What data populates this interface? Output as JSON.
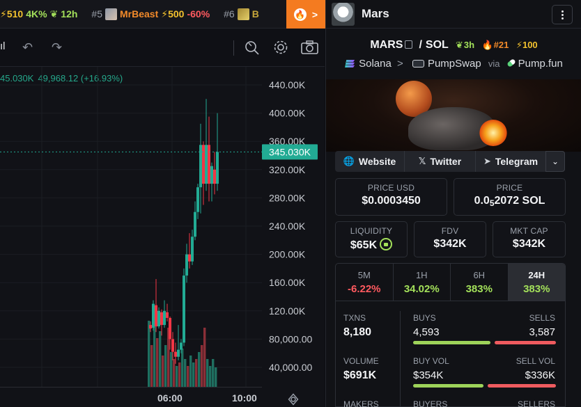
{
  "ticker": {
    "items": [
      {
        "rank": "",
        "name": "",
        "bolt": "⚡510",
        "change": "4K%",
        "change_color": "green",
        "age": "12h"
      },
      {
        "rank": "#5",
        "name": "MrBeast",
        "bolt": "⚡500",
        "change": "-60%",
        "change_color": "red",
        "age": ""
      },
      {
        "rank": "#6",
        "name": "B",
        "bolt": "",
        "change": "",
        "change_color": "",
        "age": ""
      }
    ]
  },
  "chart": {
    "ohlc_prefix": "45.030K",
    "ohlc_values": "49,968.12 (+16.93%)",
    "price_labels": [
      "440.00K",
      "400.00K",
      "360.00K",
      "320.00K",
      "280.00K",
      "240.00K",
      "200.00K",
      "160.00K",
      "120.00K",
      "80,000.00",
      "40,000.00"
    ],
    "current_price": "345.030K",
    "time_labels": [
      "06:00",
      "10:00"
    ],
    "colors": {
      "up": "#22ab94",
      "down": "#f23645",
      "current": "#22ab94"
    }
  },
  "chart_data": {
    "type": "candlestick",
    "y_axis_ticks": [
      440000,
      400000,
      360000,
      320000,
      280000,
      240000,
      200000,
      160000,
      120000,
      80000,
      40000
    ],
    "current_price": 345030,
    "x_labels": [
      "06:00",
      "10:00"
    ]
  },
  "token": {
    "name": "Mars",
    "symbol": "MARS",
    "quote": "SOL",
    "age": "3h",
    "rank": "#21",
    "boost": "100",
    "chain": "Solana",
    "dex": "PumpSwap",
    "via_label": "via",
    "launchpad": "Pump.fun"
  },
  "links": {
    "website": "Website",
    "twitter": "Twitter",
    "telegram": "Telegram"
  },
  "cards": {
    "price_usd_label": "PRICE USD",
    "price_usd": "$0.0003450",
    "price_label": "PRICE",
    "price_sol_main": "0.0",
    "price_sol_sub": "5",
    "price_sol_rest": "2072 SOL",
    "liquidity_label": "LIQUIDITY",
    "liquidity": "$65K",
    "fdv_label": "FDV",
    "fdv": "$342K",
    "mcap_label": "MKT CAP",
    "mcap": "$342K"
  },
  "timeframes": [
    {
      "label": "5M",
      "value": "-6.22%",
      "sign": "neg"
    },
    {
      "label": "1H",
      "value": "34.02%",
      "sign": "pos"
    },
    {
      "label": "6H",
      "value": "383%",
      "sign": "pos"
    },
    {
      "label": "24H",
      "value": "383%",
      "sign": "pos"
    }
  ],
  "stats": {
    "txns_label": "TXNS",
    "txns": "8,180",
    "buys_label": "BUYS",
    "buys": "4,593",
    "sells_label": "SELLS",
    "sells": "3,587",
    "volume_label": "VOLUME",
    "volume": "$691K",
    "buy_vol_label": "BUY VOL",
    "buy_vol": "$354K",
    "sell_vol_label": "SELL VOL",
    "sell_vol": "$336K",
    "makers_label": "MAKERS",
    "buyers_label": "BUYERS",
    "sellers_label": "SELLERS",
    "buys_share": 0.56,
    "buy_vol_share": 0.51
  }
}
